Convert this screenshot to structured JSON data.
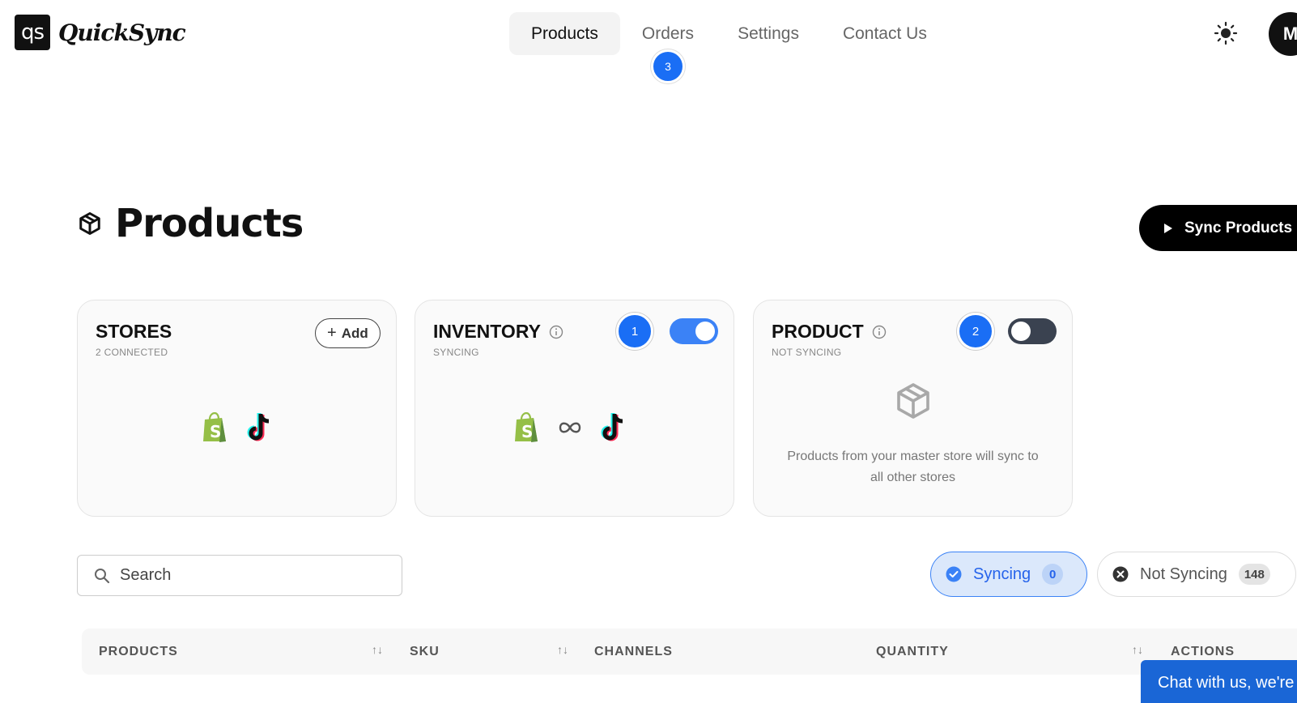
{
  "brand": {
    "logo_mark": "qs",
    "name": "QuickSync"
  },
  "nav": {
    "items": [
      {
        "label": "Products"
      },
      {
        "label": "Orders",
        "badge": "3"
      },
      {
        "label": "Settings"
      },
      {
        "label": "Contact Us"
      }
    ],
    "active": "Products"
  },
  "header": {
    "theme_icon": "sun-icon",
    "avatar_initial": "M"
  },
  "page": {
    "title": "Products",
    "title_icon": "box-icon",
    "sync_button": "Sync Products"
  },
  "cards": {
    "stores": {
      "title": "STORES",
      "subtitle": "2 CONNECTED",
      "add_label": "Add",
      "icons": [
        "shopify-icon",
        "tiktok-icon"
      ]
    },
    "inventory": {
      "title": "INVENTORY",
      "subtitle": "SYNCING",
      "step": "1",
      "toggle": "on",
      "icons": [
        "shopify-icon",
        "infinity-icon",
        "tiktok-icon"
      ]
    },
    "product": {
      "title": "PRODUCT",
      "subtitle": "NOT SYNCING",
      "step": "2",
      "toggle": "off",
      "empty_text": "Products from your master store will sync to all other stores"
    }
  },
  "search": {
    "placeholder": "Search"
  },
  "filters": {
    "syncing": {
      "label": "Syncing",
      "count": "0"
    },
    "not_syncing": {
      "label": "Not Syncing",
      "count": "148"
    }
  },
  "table": {
    "columns": [
      "PRODUCTS",
      "SKU",
      "CHANNELS",
      "QUANTITY",
      "ACTIONS"
    ]
  },
  "chat": {
    "label": "Chat with us, we're"
  },
  "colors": {
    "accent": "#1a6ef5",
    "shopify_green": "#95bf47",
    "toggle_on": "#3b82f6",
    "toggle_off": "#3a4250"
  }
}
